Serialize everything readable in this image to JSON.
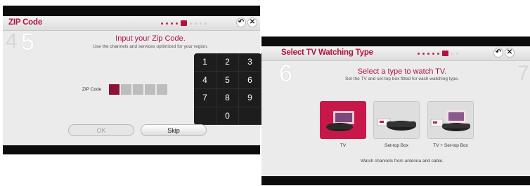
{
  "zip_screen": {
    "title": "ZIP Code",
    "step_prev": "4",
    "step": "5",
    "heading": "Input your Zip Code.",
    "subtitle": "Use the channels and services optimized for your region.",
    "zip_label": "ZIP Code",
    "ok_label": "OK",
    "skip_label": "Skip",
    "keypad": [
      "1",
      "2",
      "3",
      "4",
      "5",
      "6",
      "7",
      "8",
      "9",
      "0"
    ],
    "accent": "#b0133f"
  },
  "tv_screen": {
    "title": "Select TV Watching Type",
    "step": "6",
    "step_next": "7",
    "heading": "Select a type to watch TV.",
    "subtitle": "Set the TV and set-top box fitted for each watching type.",
    "options": [
      {
        "label": "TV",
        "selected": true
      },
      {
        "label": "Set-top Box",
        "selected": false
      },
      {
        "label": "TV + Set-top Box",
        "selected": false
      }
    ],
    "footer": "Watch channels from antenna and cable.",
    "accent": "#c8184a"
  },
  "icons": {
    "back": "back-arrow-icon",
    "close": "close-icon"
  }
}
